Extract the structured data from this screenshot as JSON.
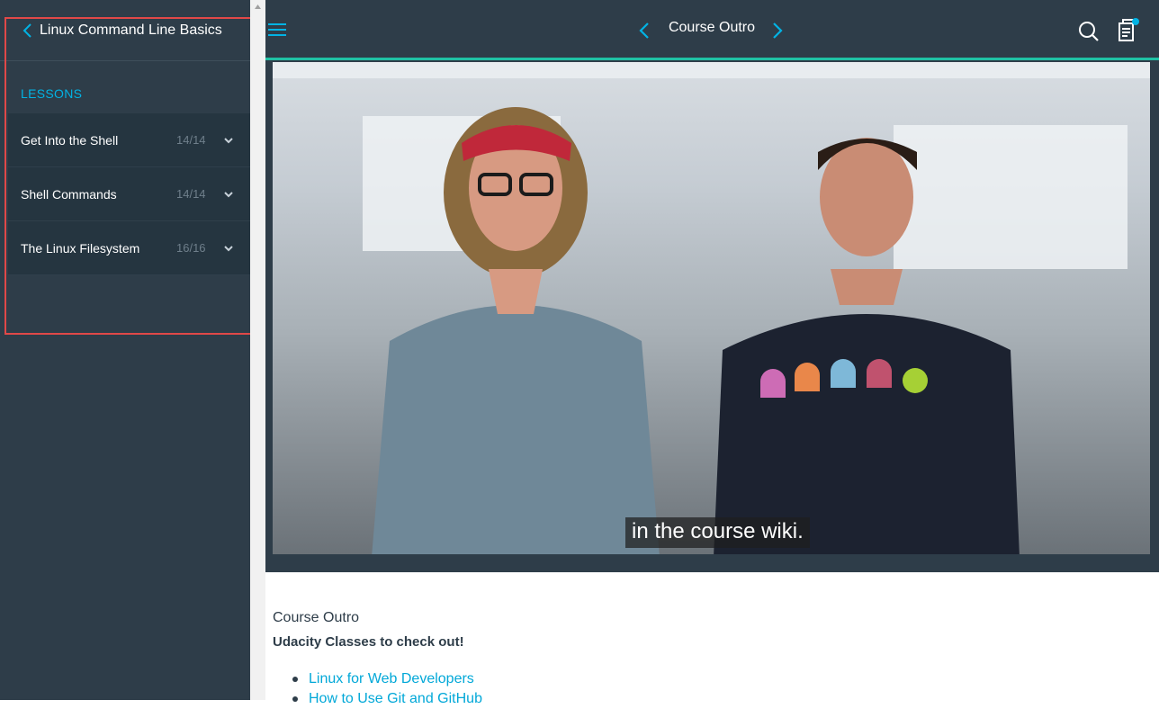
{
  "sidebar": {
    "course_title": "Linux Command Line Basics",
    "lessons_heading": "LESSONS",
    "lessons": [
      {
        "label": "Get Into the Shell",
        "count": "14/14"
      },
      {
        "label": "Shell Commands",
        "count": "14/14"
      },
      {
        "label": "The Linux Filesystem",
        "count": "16/16"
      }
    ]
  },
  "topbar": {
    "concept_title": "Course Outro",
    "icons": [
      "menu-icon",
      "chevron-left-icon",
      "chevron-right-icon",
      "search-icon",
      "notes-icon"
    ],
    "accent_color": "#1fc1a4",
    "brand_color": "#02b3e4"
  },
  "video": {
    "caption": "in the course wiki."
  },
  "content": {
    "title": "Course Outro",
    "subtitle": "Udacity Classes to check out!",
    "links": [
      {
        "label": "Linux for Web Developers"
      },
      {
        "label": "How to Use Git and GitHub"
      }
    ]
  }
}
